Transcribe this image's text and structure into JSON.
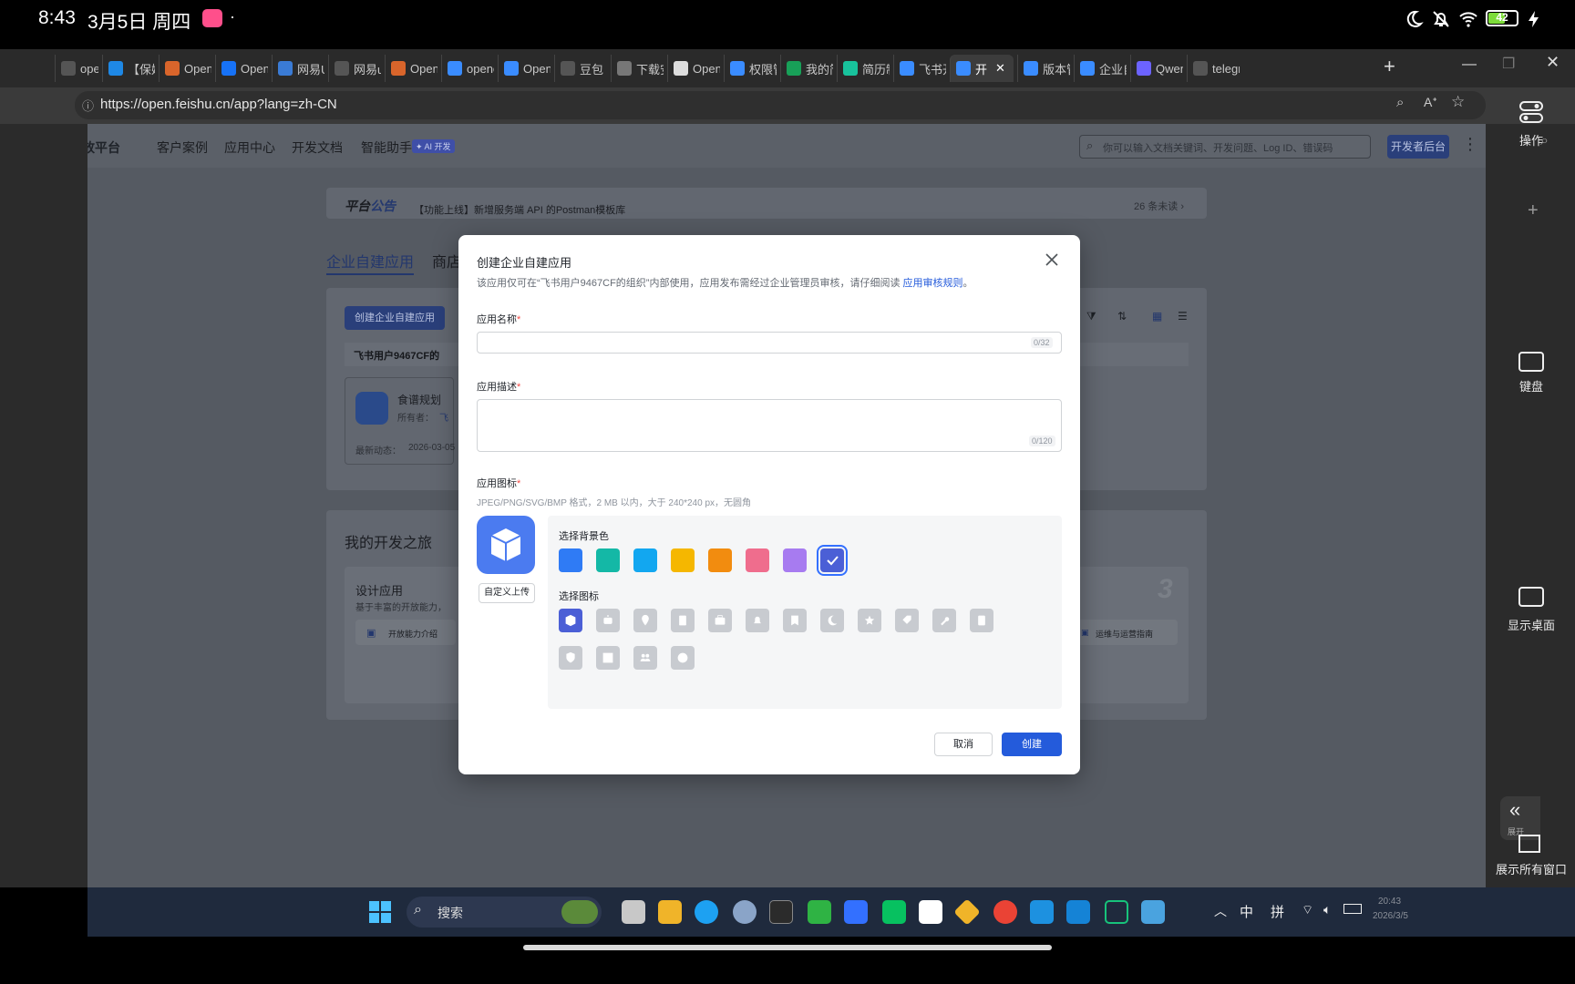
{
  "status_bar": {
    "time": "8:43",
    "date": "3月5日 周四",
    "battery": "42"
  },
  "browser": {
    "tabs": [
      {
        "label": "openc",
        "color": "#555"
      },
      {
        "label": "【保姆",
        "color": "#1e88e5"
      },
      {
        "label": "OpenC",
        "color": "#d9652b"
      },
      {
        "label": "OpenC",
        "color": "#1772f6"
      },
      {
        "label": "网易U",
        "color": "#3a7bd5"
      },
      {
        "label": "网易u",
        "color": "#555"
      },
      {
        "label": "OpenC",
        "color": "#d9652b"
      },
      {
        "label": "opencl",
        "color": "#3a8cff"
      },
      {
        "label": "Openc",
        "color": "#3a8cff"
      },
      {
        "label": "豆包",
        "color": "#555"
      },
      {
        "label": "下载安",
        "color": "#777"
      },
      {
        "label": "OpenC",
        "color": "#ddd"
      },
      {
        "label": "权限管",
        "color": "#3a8cff"
      },
      {
        "label": "我的简",
        "color": "#18a058"
      },
      {
        "label": "简历制",
        "color": "#18c29c"
      },
      {
        "label": "飞书开",
        "color": "#3a8cff"
      },
      {
        "label": "开",
        "color": "#3a8cff"
      },
      {
        "label": "版本管",
        "color": "#3a8cff"
      },
      {
        "label": "企业自",
        "color": "#3a8cff"
      },
      {
        "label": "Qwen",
        "color": "#6c63ff"
      },
      {
        "label": "telegr",
        "color": "#555"
      }
    ],
    "url": "https://open.feishu.cn/app?lang=zh-CN"
  },
  "site": {
    "logo": "飞书开放平台",
    "nav": [
      "客户案例",
      "应用中心",
      "开发文档",
      "智能助手"
    ],
    "ai_badge": "✦ AI 开发",
    "search_placeholder": "你可以输入文档关键词、开发问题、Log ID、错误码",
    "dev_console": "开发者后台",
    "notice_label_a": "平台",
    "notice_label_b": "公告",
    "notice_text": "【功能上线】新增服务端 API 的Postman模板库",
    "notice_unread": "26 条未读 ›",
    "tab_enterprise": "企业自建应用",
    "tab_store": "商店",
    "create_app_btn": "创建企业自建应用",
    "org_name": "飞书用户9467CF的",
    "app_name": "食谱规划",
    "owner_label": "所有者：",
    "owner_value": "飞",
    "recent_label": "最新动态：",
    "recent_value": "2026-03-05",
    "journey_title": "我的开发之旅",
    "design_title": "设计应用",
    "design_desc": "基于丰富的开放能力，",
    "capability_link": "开放能力介绍",
    "ops_link": "运维与运营指南",
    "step_num": "3"
  },
  "modal": {
    "title": "创建企业自建应用",
    "desc_prefix": "该应用仅可在“飞书用户9467CF的组织”内部使用，应用发布需经过企业管理员审核，请仔细阅读",
    "desc_link": "应用审核规则",
    "desc_suffix": "。",
    "name_label": "应用名称",
    "name_counter": "0/32",
    "desc_label": "应用描述",
    "desc_counter": "0/120",
    "icon_label": "应用图标",
    "icon_hint": "JPEG/PNG/SVG/BMP 格式，2 MB 以内，大于 240*240 px，无圆角",
    "upload_btn": "自定义上传",
    "bg_label": "选择背景色",
    "bg_colors": [
      "#2f7bf5",
      "#14b8a6",
      "#12a7f0",
      "#f5b700",
      "#f28c0f",
      "#ef6d8d",
      "#a77bf0",
      "#4b5fd6"
    ],
    "icon_select_label": "选择图标",
    "icons": [
      "cube-icon",
      "robot-icon",
      "location-pin-icon",
      "book-icon",
      "briefcase-icon",
      "bell-icon",
      "bookmark-icon",
      "moon-icon",
      "star-icon",
      "tag-icon",
      "wrench-icon",
      "document-icon",
      "shield-icon",
      "layout-icon",
      "people-icon",
      "code-icon"
    ],
    "cancel": "取消",
    "create": "创建"
  },
  "side_panel": {
    "operate": "操作",
    "keyboard": "键盘",
    "desktop": "显示桌面",
    "collapse": "展开",
    "all_windows": "展示所有窗口"
  },
  "taskbar": {
    "search": "搜索",
    "ime_lang": "中",
    "ime_mode": "拼",
    "clock_time": "20:43",
    "clock_date": "2026/3/5"
  }
}
